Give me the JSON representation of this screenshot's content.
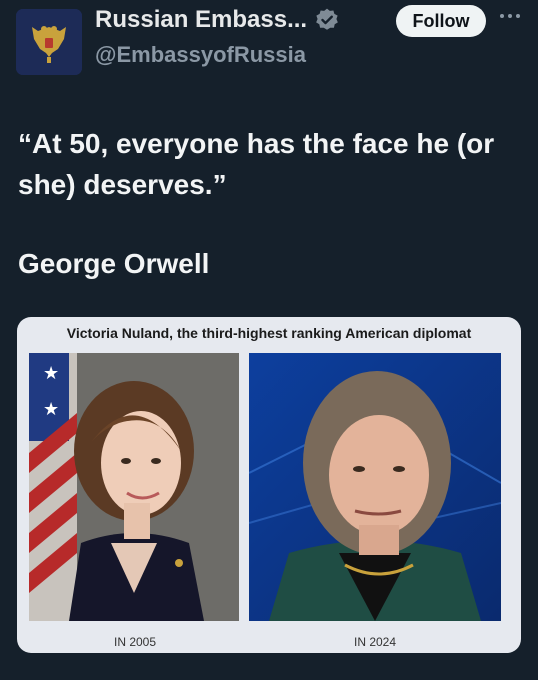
{
  "header": {
    "display_name": "Russian Embass...",
    "handle": "@EmbassyofRussia",
    "follow_label": "Follow",
    "verified_icon": "verified-badge-icon",
    "more_icon": "more-icon"
  },
  "tweet": {
    "quote_text": "“At 50, everyone has the face he (or she) deserves.”",
    "author": "George Orwell"
  },
  "image_card": {
    "caption": "Victoria Nuland,  the third-highest ranking American diplomat",
    "left_label": "IN 2005",
    "right_label": "IN 2024"
  },
  "colors": {
    "background": "#15202b",
    "text_primary": "#e7e9ea",
    "text_secondary": "#8b98a5",
    "follow_bg": "#eff3f4"
  }
}
